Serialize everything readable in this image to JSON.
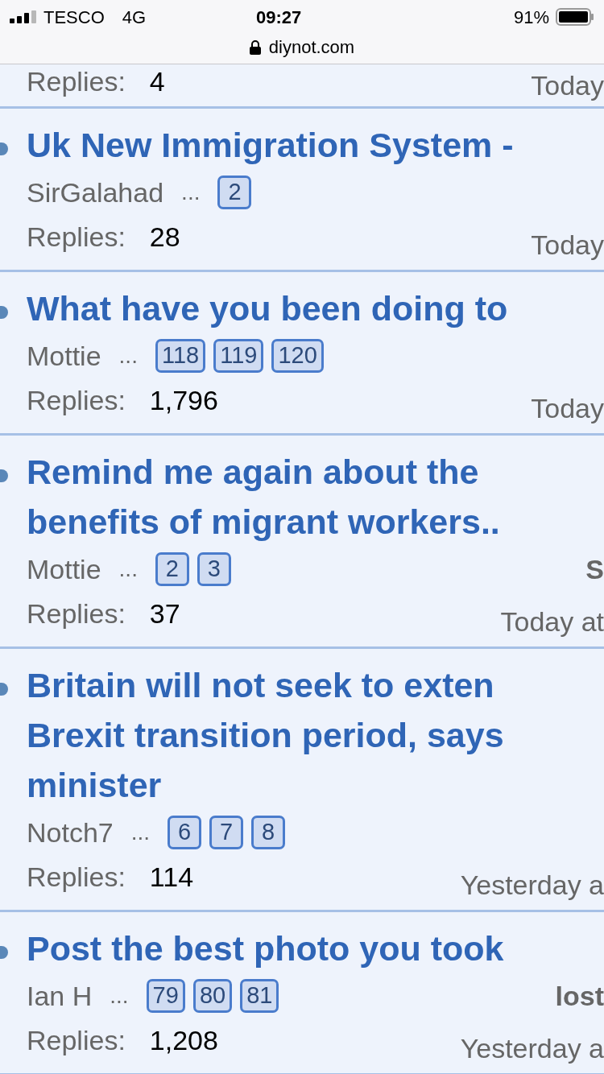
{
  "status_bar": {
    "carrier": "TESCO",
    "network": "4G",
    "time": "09:27",
    "battery": "91%"
  },
  "address_bar": {
    "url": "diynot.com"
  },
  "threads": [
    {
      "replies_label": "Replies:",
      "replies": "4",
      "last_time": "Today"
    },
    {
      "title": "Uk New Immigration System -",
      "author": "SirGalahad",
      "ellipsis": "...",
      "pages": [
        "2"
      ],
      "replies_label": "Replies:",
      "replies": "28",
      "last_time": "Today"
    },
    {
      "title": "What have you been doing to",
      "author": "Mottie",
      "ellipsis": "...",
      "pages": [
        "118",
        "119",
        "120"
      ],
      "replies_label": "Replies:",
      "replies": "1,796",
      "last_time": "Today"
    },
    {
      "title_lines": [
        "Remind me again about the",
        "benefits of migrant workers.."
      ],
      "author": "Mottie",
      "ellipsis": "...",
      "pages": [
        "2",
        "3"
      ],
      "last_poster": "S",
      "replies_label": "Replies:",
      "replies": "37",
      "last_time": "Today at"
    },
    {
      "title_lines": [
        "Britain will not seek to exten",
        "Brexit transition period, says",
        "minister"
      ],
      "author": "Notch7",
      "ellipsis": "...",
      "pages": [
        "6",
        "7",
        "8"
      ],
      "replies_label": "Replies:",
      "replies": "114",
      "last_time": "Yesterday a"
    },
    {
      "title": "Post the best photo you took",
      "author": "Ian H",
      "ellipsis": "...",
      "pages": [
        "79",
        "80",
        "81"
      ],
      "last_poster": "lost",
      "replies_label": "Replies:",
      "replies": "1,208",
      "last_time": "Yesterday a"
    }
  ]
}
